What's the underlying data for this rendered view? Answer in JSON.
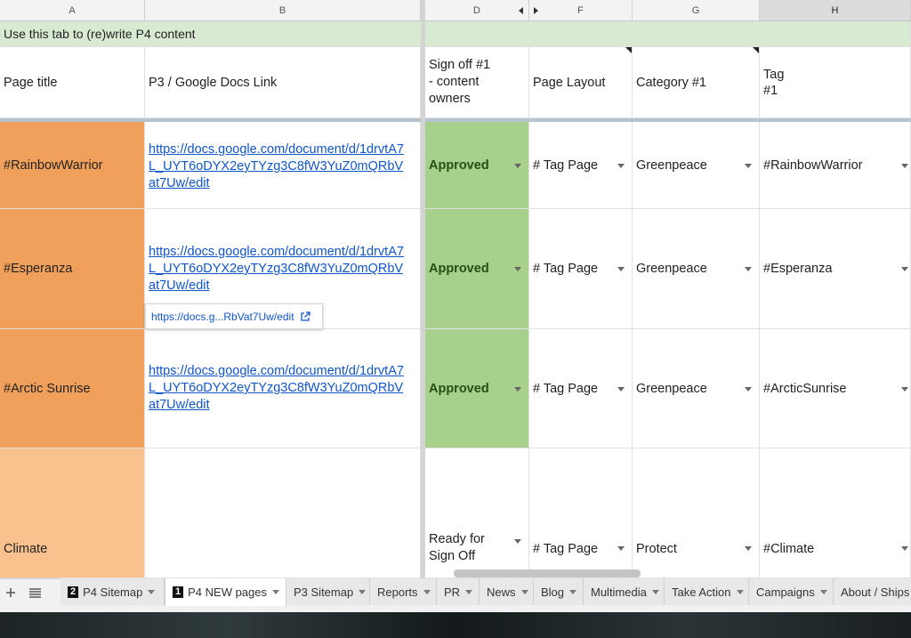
{
  "columns": {
    "a": "A",
    "b": "B",
    "d": "D",
    "f": "F",
    "g": "G",
    "h": "H"
  },
  "banner": "Use this tab to (re)write P4 content",
  "headers": {
    "page_title": "Page title",
    "link": "P3 / Google Docs Link",
    "signoff_l1": "Sign off #1",
    "signoff_l2": "- content",
    "signoff_l3": "owners",
    "layout": "Page Layout",
    "category": "Category #1",
    "tag_l1": "Tag",
    "tag_l2": "#1"
  },
  "rows": [
    {
      "title": "#RainbowWarrior",
      "link_l1": "https://docs.google.com/document/d/1drvtA7",
      "link_l2": "L_UYT6oDYX2eyTYzg3C8fW3YuZ0mQRbV",
      "link_l3": "at7Uw/edit",
      "signoff": "Approved",
      "layout": "# Tag Page",
      "category": "Greenpeace",
      "tag": "#RainbowWarrior"
    },
    {
      "title": "#Esperanza",
      "link_l1": "https://docs.google.com/document/d/1drvtA7",
      "link_l2": "L_UYT6oDYX2eyTYzg3C8fW3YuZ0mQRbV",
      "link_l3": "at7Uw/edit",
      "signoff": "Approved",
      "layout": "# Tag Page",
      "category": "Greenpeace",
      "tag": "#Esperanza"
    },
    {
      "title": "#Arctic Sunrise",
      "link_l1": "https://docs.google.com/document/d/1drvtA7",
      "link_l2": "L_UYT6oDYX2eyTYzg3C8fW3YuZ0mQRbV",
      "link_l3": "at7Uw/edit",
      "signoff": "Approved",
      "layout": "# Tag Page",
      "category": "Greenpeace",
      "tag": "#ArcticSunrise"
    },
    {
      "title": "Climate",
      "signoff_l1": "Ready for",
      "signoff_l2": "Sign Off",
      "layout": "# Tag Page",
      "category": "Protect",
      "tag": "#Climate"
    }
  ],
  "link_tooltip": "https://docs.g...RbVat7Uw/edit",
  "tabs": {
    "add_icon": "plus-icon",
    "list_icon": "list-icon",
    "t1_num": "2",
    "t1": "P4 Sitemap",
    "t2_num": "1",
    "t2": "P4 NEW pages",
    "t3": "P3 Sitemap",
    "t4": "Reports",
    "t5": "PR",
    "t6": "News",
    "t7": "Blog",
    "t8": "Multimedia",
    "t9": "Take Action",
    "t10": "Campaigns",
    "t11": "About / Ships"
  },
  "colors": {
    "banner": "#d9ead3",
    "orange_dark": "#f0a05a",
    "orange_light": "#f9c18d",
    "approved_green": "#a8d08d",
    "link": "#1155cc"
  }
}
